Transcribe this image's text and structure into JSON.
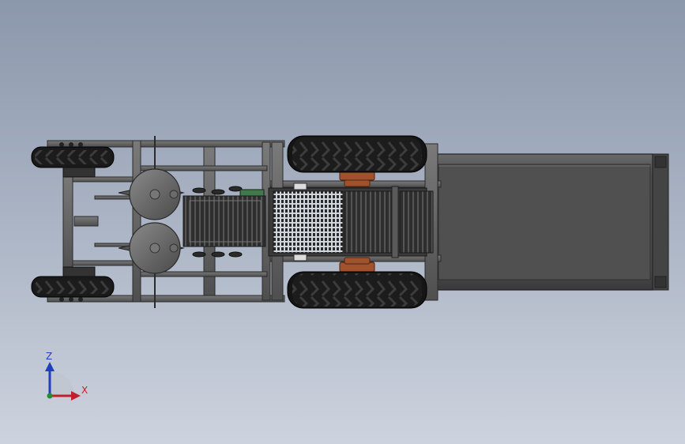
{
  "viewport": {
    "background_top": "#8b97ab",
    "background_bottom": "#cdd3de"
  },
  "model": {
    "frame_color": "#5f5f5f",
    "tire_color": "#1c1c1c",
    "bearing_color": "#a0522d",
    "conveyor_color": "#3a3a3a",
    "hopper_color": "#505050",
    "accent_green": "#3e7a4a"
  },
  "triad": {
    "axis_z_label": "Z",
    "axis_x_label": "X",
    "z_color": "#1f3fbf",
    "x_color": "#c0202a",
    "y_color": "#1f8f2f"
  }
}
